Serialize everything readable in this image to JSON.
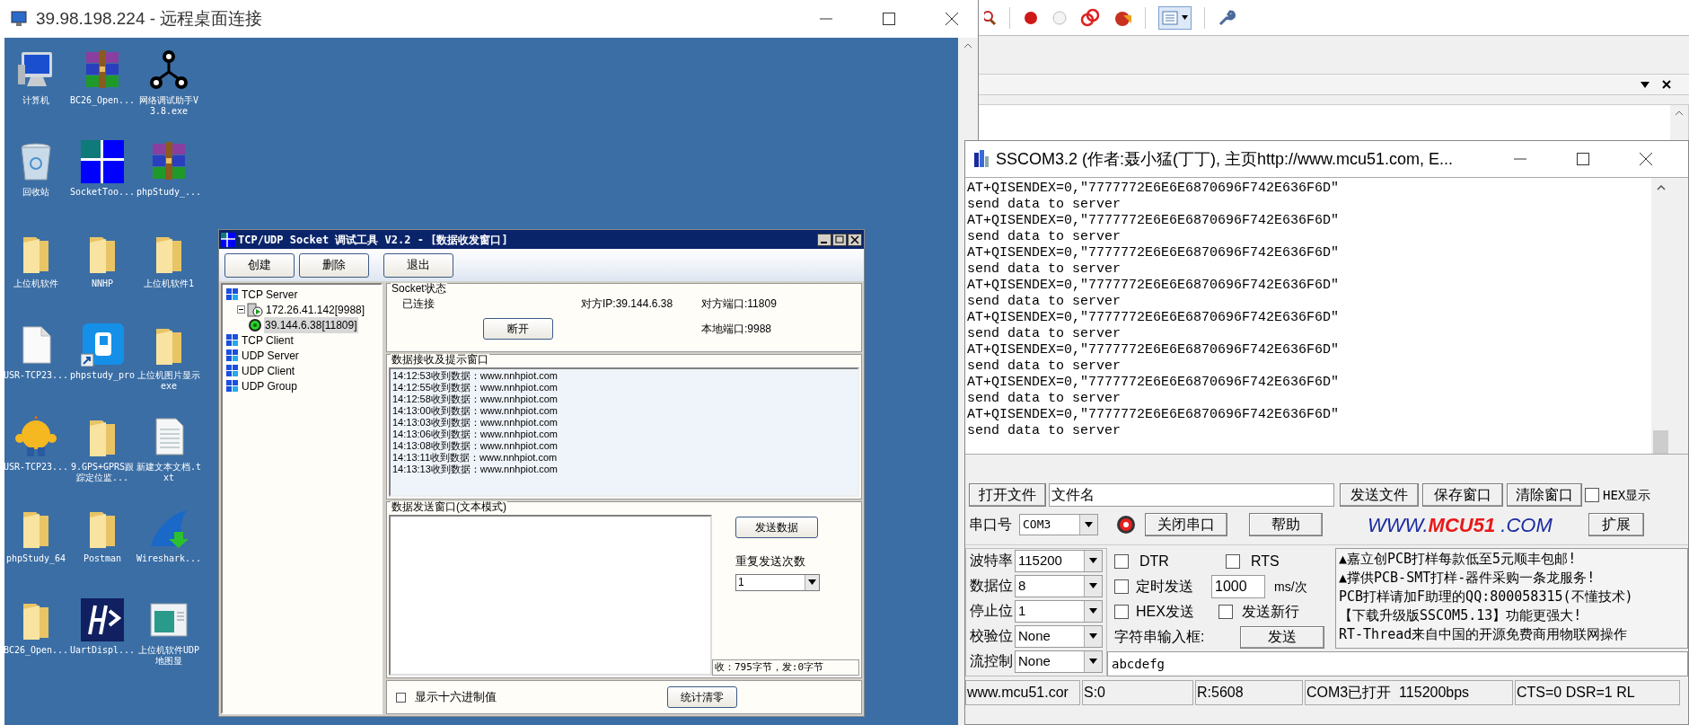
{
  "remote_desktop": {
    "title": "39.98.198.224 - 远程桌面连接"
  },
  "desktop_icons": [
    {
      "label": "计算机",
      "kind": "computer"
    },
    {
      "label": "BC26_Open...",
      "kind": "archive"
    },
    {
      "label": "网络调试助手V3.8.exe",
      "kind": "network"
    },
    {
      "label": "回收站",
      "kind": "recycle"
    },
    {
      "label": "SocketToo...",
      "kind": "socket"
    },
    {
      "label": "phpStudy_...",
      "kind": "archive"
    },
    {
      "label": "上位机软件",
      "kind": "folder"
    },
    {
      "label": "NNHP",
      "kind": "folder"
    },
    {
      "label": "上位机软件1",
      "kind": "folder"
    },
    {
      "label": "USR-TCP23...",
      "kind": "document"
    },
    {
      "label": "phpstudy_pro",
      "kind": "phpstudy"
    },
    {
      "label": "上位机图片显示exe",
      "kind": "folder"
    },
    {
      "label": "USR-TCP23...",
      "kind": "mascot"
    },
    {
      "label": "9.GPS+GPRS跟踪定位监...",
      "kind": "folder"
    },
    {
      "label": "新建文本文档.txt",
      "kind": "textfile"
    },
    {
      "label": "phpStudy_64",
      "kind": "folder"
    },
    {
      "label": "Postman",
      "kind": "folder"
    },
    {
      "label": "Wireshark...",
      "kind": "wireshark"
    },
    {
      "label": "BC26_Open...",
      "kind": "folder"
    },
    {
      "label": "UartDispl...",
      "kind": "uart"
    },
    {
      "label": "上位机软件UDP地图显",
      "kind": "window"
    }
  ],
  "tcp_tool": {
    "title": "TCP/UDP Socket 调试工具 V2.2 - [数据收发窗口]",
    "toolbar": [
      "创建",
      "删除",
      "退出"
    ],
    "tree": [
      {
        "label": "TCP Server",
        "kind": "group",
        "selected": false,
        "children": [
          {
            "label": "172.26.41.142[9988]",
            "kind": "server",
            "selected": false,
            "expanded": true,
            "children": [
              {
                "label": "39.144.6.38[11809]",
                "kind": "client",
                "selected": true
              }
            ]
          }
        ]
      },
      {
        "label": "TCP Client",
        "kind": "group",
        "selected": false
      },
      {
        "label": "UDP Server",
        "kind": "group",
        "selected": false
      },
      {
        "label": "UDP Client",
        "kind": "group",
        "selected": false
      },
      {
        "label": "UDP Group",
        "kind": "group",
        "selected": false
      }
    ],
    "socket_status": {
      "legend": "Socket状态",
      "status": "已连接",
      "remote_ip": "对方IP:39.144.6.38",
      "remote_port": "对方端口:11809",
      "disconnect": "断开",
      "local_port": "本地端口:9988"
    },
    "receive": {
      "legend": "数据接收及提示窗口",
      "lines": [
        "14:12:53收到数据：www.nnhpiot.com",
        "14:12:55收到数据：www.nnhpiot.com",
        "14:12:58收到数据：www.nnhpiot.com",
        "14:13:00收到数据：www.nnhpiot.com",
        "14:13:03收到数据：www.nnhpiot.com",
        "14:13:06收到数据：www.nnhpiot.com",
        "14:13:08收到数据：www.nnhpiot.com",
        "14:13:11收到数据：www.nnhpiot.com",
        "14:13:13收到数据：www.nnhpiot.com"
      ]
    },
    "send": {
      "legend": "数据发送窗口(文本模式)",
      "send_button": "发送数据",
      "repeat_label": "重复发送次数",
      "repeat_value": "1",
      "stats": "收：795字节，发:0字节"
    },
    "hex_checkbox": {
      "label": "显示十六进制值",
      "checked": false
    },
    "clear_button": "统计清零"
  },
  "sscom": {
    "title": "SSCOM3.2 (作者:聂小猛(丁丁), 主页http://www.mcu51.com,  E...",
    "output": [
      "AT+QISENDEX=0,\"7777772E6E6E6870696F742E636F6D\"",
      "send data to server",
      "AT+QISENDEX=0,\"7777772E6E6E6870696F742E636F6D\"",
      "send data to server",
      "AT+QISENDEX=0,\"7777772E6E6E6870696F742E636F6D\"",
      "send data to server",
      "AT+QISENDEX=0,\"7777772E6E6E6870696F742E636F6D\"",
      "send data to server",
      "AT+QISENDEX=0,\"7777772E6E6E6870696F742E636F6D\"",
      "send data to server",
      "AT+QISENDEX=0,\"7777772E6E6E6870696F742E636F6D\"",
      "send data to server",
      "AT+QISENDEX=0,\"7777772E6E6E6870696F742E636F6D\"",
      "send data to server",
      "AT+QISENDEX=0,\"7777772E6E6E6870696F742E636F6D\"",
      "send data to server"
    ],
    "open_file": "打开文件",
    "filename": "文件名",
    "send_file": "发送文件",
    "save_window": "保存窗口",
    "clear_window": "清除窗口",
    "hex_display": {
      "label": "HEX显示",
      "checked": false
    },
    "port_label": "串口号",
    "port": "COM3",
    "close_port": "关闭串口",
    "help": "帮助",
    "logo": [
      "WWW.",
      "MCU51",
      ".COM"
    ],
    "expand": "扩展",
    "settings": [
      {
        "label": "波特率",
        "value": "115200"
      },
      {
        "label": "数据位",
        "value": "8"
      },
      {
        "label": "停止位",
        "value": "1"
      },
      {
        "label": "校验位",
        "value": "None"
      },
      {
        "label": "流控制",
        "value": "None"
      }
    ],
    "dtr": {
      "label": "DTR",
      "checked": false
    },
    "rts": {
      "label": "RTS",
      "checked": false
    },
    "timed_send": {
      "label": "定时发送",
      "checked": false
    },
    "interval": "1000",
    "interval_unit": "ms/次",
    "hex_send": {
      "label": "HEX发送",
      "checked": false
    },
    "send_newline": {
      "label": "发送新行",
      "checked": false
    },
    "input_label": "字符串输入框:",
    "send": "发送",
    "input_value": "abcdefg",
    "ads": [
      "▲嘉立创PCB打样每款低至5元顺丰包邮!",
      "▲撑供PCB-SMT打样-器件采购一条龙服务!",
      "PCB打样请加F助理的QQ:800058315(不懂技术)",
      "【下载升级版SSCOM5.13】功能更强大!",
      "RT-Thread来自中国的开源免费商用物联网操作"
    ],
    "status": [
      "www.mcu51.cor",
      "S:0",
      "R:5608",
      "COM3已打开  115200bps",
      "CTS=0 DSR=1 RL"
    ]
  }
}
